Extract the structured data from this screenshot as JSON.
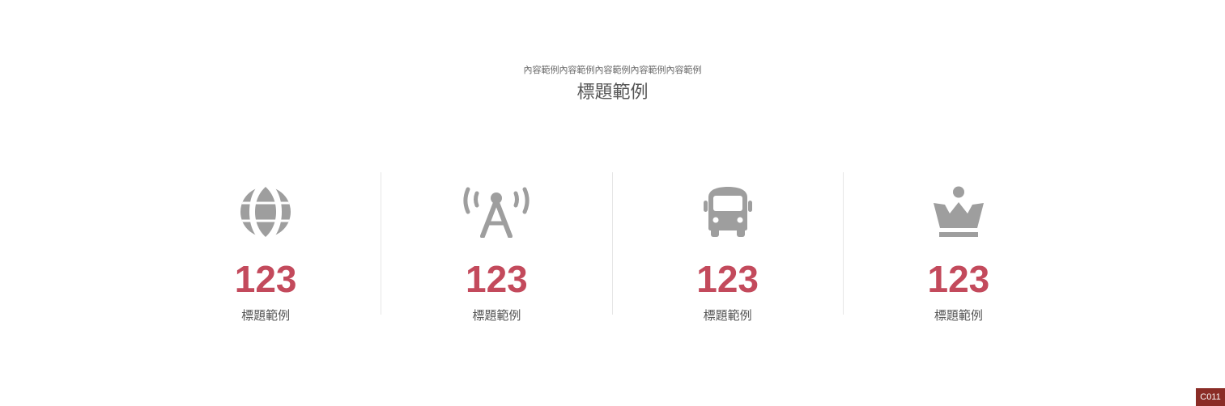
{
  "header": {
    "subtitle": "內容範例內容範例內容範例內容範例內容範例",
    "title": "標題範例"
  },
  "stats": [
    {
      "icon": "globe-icon",
      "number": "123",
      "label": "標題範例"
    },
    {
      "icon": "antenna-icon",
      "number": "123",
      "label": "標題範例"
    },
    {
      "icon": "bus-icon",
      "number": "123",
      "label": "標題範例"
    },
    {
      "icon": "crown-icon",
      "number": "123",
      "label": "標題範例"
    }
  ],
  "badge": {
    "code": "C011"
  },
  "colors": {
    "accent": "#c34a5c",
    "icon": "#9e9e9e",
    "text": "#555555",
    "divider": "#e6e6e6",
    "badge": "#8a2c26"
  }
}
